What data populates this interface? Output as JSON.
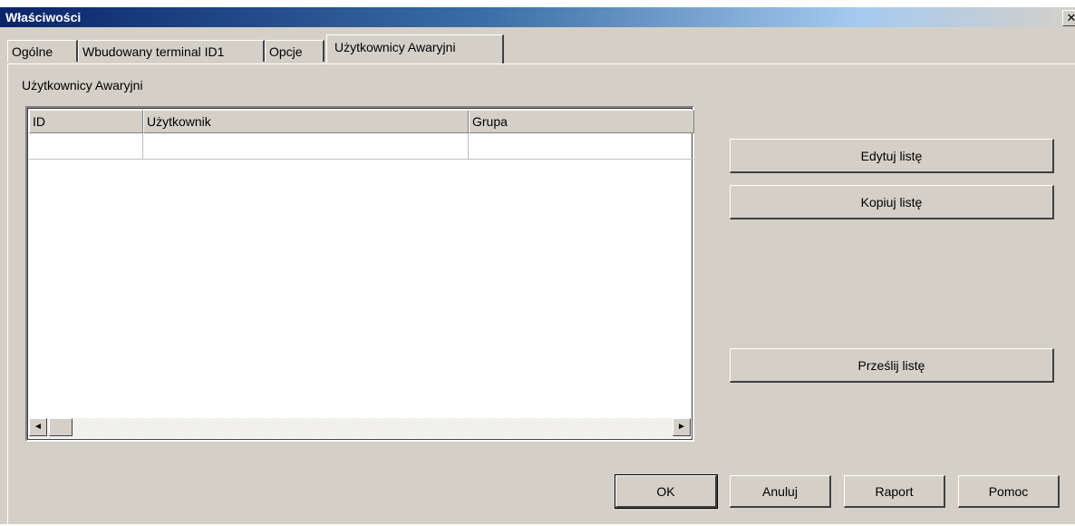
{
  "window": {
    "title": "Właściwości",
    "close_glyph": "✕"
  },
  "tabs": [
    {
      "label": "Ogólne"
    },
    {
      "label": "Wbudowany terminal ID1"
    },
    {
      "label": "Opcje"
    },
    {
      "label": "Użytkownicy Awaryjni",
      "active": true
    }
  ],
  "group": {
    "label": "Użytkownicy Awaryjni"
  },
  "list": {
    "columns": [
      "ID",
      "Użytkownik",
      "Grupa"
    ],
    "rows": [
      {
        "id": "",
        "user": "",
        "group": ""
      }
    ],
    "scroll_left_glyph": "◄",
    "scroll_right_glyph": "►"
  },
  "side_buttons": {
    "edit": "Edytuj listę",
    "copy": "Kopiuj listę",
    "send": "Prześlij listę"
  },
  "footer_buttons": {
    "ok": "OK",
    "cancel": "Anuluj",
    "report": "Raport",
    "help": "Pomoc"
  }
}
